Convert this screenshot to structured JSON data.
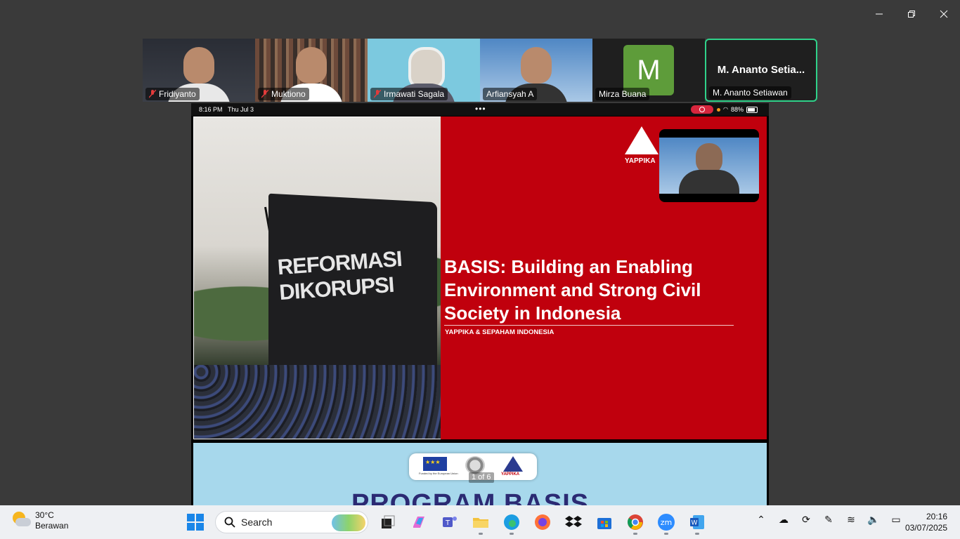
{
  "participants": [
    {
      "name": "Fridiyanto",
      "muted": true
    },
    {
      "name": "Muktiono",
      "muted": true
    },
    {
      "name": "Irmawati Sagala",
      "muted": true
    },
    {
      "name": "Arfiansyah A",
      "muted": false
    },
    {
      "name": "Mirza Buana",
      "muted": false,
      "avatar_letter": "M",
      "avatar_color": "#5e9c3a"
    },
    {
      "name": "M. Ananto Setiawan",
      "display_title": "M. Ananto Setia...",
      "muted": false,
      "active_speaker": true
    }
  ],
  "ipad_status": {
    "time": "8:16 PM",
    "date": "Thu Jul 3",
    "battery": "88%",
    "recording_color": "#d7263d"
  },
  "slide": {
    "flag_text": [
      "REFORMASI",
      "DIKORUPSI"
    ],
    "logo_text": "YAPPIKA",
    "title": "BASIS: Building an Enabling Environment and Strong Civil Society in Indonesia",
    "subtitle": "YAPPIKA & SEPAHAM INDONESIA",
    "accent_color": "#c0000d"
  },
  "next_slide": {
    "eu_label": "Funded by the European Union",
    "logo_text": "YAPPIKA",
    "pager": "1 of 6",
    "title": "PROGRAM BASIS"
  },
  "window_controls": [
    "minimize-icon",
    "restore-icon",
    "close-icon"
  ],
  "taskbar": {
    "weather_temp": "30°C",
    "weather_desc": "Berawan",
    "search_placeholder": "Search",
    "apps": [
      "start",
      "task-view",
      "copilot",
      "teams",
      "file-explorer",
      "edge",
      "firefox",
      "dropbox",
      "store",
      "chrome",
      "zoom",
      "word"
    ],
    "time": "20:16",
    "date": "03/07/2025"
  }
}
